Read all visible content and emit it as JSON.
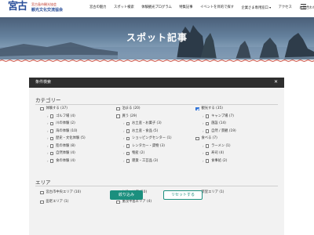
{
  "header": {
    "logo_main": "宮古",
    "logo_sub1": "宮古島市観光協会",
    "logo_sub2": "観光文化交流協会",
    "nav": [
      {
        "label": "宮古の魅力",
        "dropdown": false
      },
      {
        "label": "スポット検索",
        "dropdown": false
      },
      {
        "label": "体験観光プログラム",
        "dropdown": false
      },
      {
        "label": "特集記事",
        "dropdown": false
      },
      {
        "label": "イベントを目的で探す",
        "dropdown": false
      },
      {
        "label": "企業さま専用窓口",
        "dropdown": true
      },
      {
        "label": "アクセス",
        "dropdown": false
      },
      {
        "label": "お問合わせ",
        "dropdown": true
      }
    ]
  },
  "hero": {
    "title": "スポット記事"
  },
  "panel": {
    "header_label": "条件検索",
    "close_icon": "x-icon",
    "category_title": "カテゴリー",
    "area_title": "エリア",
    "categories": [
      {
        "label": "体験する (37)",
        "checked": false,
        "indent": 0,
        "col": 0,
        "row": 0
      },
      {
        "label": "ゴルフ場 (4)",
        "checked": false,
        "indent": 1,
        "col": 0,
        "row": 1
      },
      {
        "label": "川の体験 (2)",
        "checked": false,
        "indent": 1,
        "col": 0,
        "row": 2
      },
      {
        "label": "海の体験 (10)",
        "checked": false,
        "indent": 1,
        "col": 0,
        "row": 3
      },
      {
        "label": "歴史・文化体験 (5)",
        "checked": false,
        "indent": 1,
        "col": 0,
        "row": 4
      },
      {
        "label": "陸の体験 (8)",
        "checked": false,
        "indent": 1,
        "col": 0,
        "row": 5
      },
      {
        "label": "自然体験 (4)",
        "checked": false,
        "indent": 1,
        "col": 0,
        "row": 6
      },
      {
        "label": "食の体験 (4)",
        "checked": false,
        "indent": 1,
        "col": 0,
        "row": 7
      },
      {
        "label": "泊まる (20)",
        "checked": false,
        "indent": 0,
        "col": 1,
        "row": 0
      },
      {
        "label": "買う (29)",
        "checked": false,
        "indent": 0,
        "col": 1,
        "row": 1
      },
      {
        "label": "お土産・お菓子 (3)",
        "checked": false,
        "indent": 1,
        "col": 1,
        "row": 2
      },
      {
        "label": "お土産・食品 (5)",
        "checked": false,
        "indent": 1,
        "col": 1,
        "row": 3
      },
      {
        "label": "ショッピングセンター (1)",
        "checked": false,
        "indent": 1,
        "col": 1,
        "row": 4
      },
      {
        "label": "レンタカー・貸物 (3)",
        "checked": false,
        "indent": 1,
        "col": 1,
        "row": 5
      },
      {
        "label": "物産 (2)",
        "checked": false,
        "indent": 1,
        "col": 1,
        "row": 6
      },
      {
        "label": "雑貨・工芸品 (3)",
        "checked": false,
        "indent": 1,
        "col": 1,
        "row": 7
      },
      {
        "label": "観光する (35)",
        "checked": true,
        "indent": 0,
        "col": 2,
        "row": 0
      },
      {
        "label": "キャンプ場 (7)",
        "checked": false,
        "indent": 1,
        "col": 2,
        "row": 1
      },
      {
        "label": "施設 (14)",
        "checked": false,
        "indent": 1,
        "col": 2,
        "row": 2
      },
      {
        "label": "自然 / 景観 (19)",
        "checked": false,
        "indent": 1,
        "col": 2,
        "row": 3
      },
      {
        "label": "食べる (7)",
        "checked": false,
        "indent": 0,
        "col": 2,
        "row": 4
      },
      {
        "label": "ラーメン (1)",
        "checked": false,
        "indent": 1,
        "col": 2,
        "row": 5
      },
      {
        "label": "寿司 (4)",
        "checked": false,
        "indent": 1,
        "col": 2,
        "row": 6
      },
      {
        "label": "食事処 (2)",
        "checked": false,
        "indent": 1,
        "col": 2,
        "row": 7
      }
    ],
    "areas": [
      {
        "label": "宮古市中央エリア (10)",
        "checked": false,
        "col": 0,
        "row": 0
      },
      {
        "label": "川井エリア (10)",
        "checked": false,
        "col": 1,
        "row": 0
      },
      {
        "label": "新里エリア (1)",
        "checked": false,
        "col": 2,
        "row": 0
      },
      {
        "label": "田老エリア (1)",
        "checked": false,
        "col": 0,
        "row": 1
      },
      {
        "label": "重茂半島エリア (4)",
        "checked": false,
        "col": 1,
        "row": 1
      }
    ],
    "search_button": "絞り込み",
    "reset_button": "リセットする"
  },
  "colors": {
    "accent": "#1b8f7e",
    "checkbox_on": "#2b6fd6",
    "panel_head": "#2e2e2e",
    "panel_bg": "#f2f2f2",
    "logo": "#2a4f9a"
  }
}
